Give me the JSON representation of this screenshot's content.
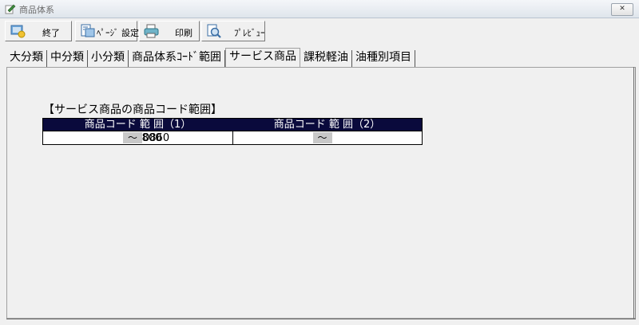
{
  "window": {
    "title": "商品体系",
    "close_label": "✕"
  },
  "toolbar": {
    "exit_label": "終了",
    "page_setup_label": "ﾍﾟｰｼﾞ 設定",
    "print_label": "印刷",
    "preview_label": "ﾌﾟﾚﾋﾞｭｰ"
  },
  "tabs": [
    {
      "label": "大分類"
    },
    {
      "label": "中分類"
    },
    {
      "label": "小分類"
    },
    {
      "label": "商品体系ｺｰﾄﾞ範囲"
    },
    {
      "label": "サービス商品"
    },
    {
      "label": "課税軽油"
    },
    {
      "label": "油種別項目"
    }
  ],
  "active_tab": "サービス商品",
  "section": {
    "title": "【サービス商品の商品コード範囲】",
    "columns": [
      "商品コード 範 囲（1）",
      "商品コード 範 囲（2）"
    ],
    "range1": {
      "from": "0800",
      "separator": "～",
      "to": "0860"
    },
    "range2": {
      "from": "",
      "separator": "～",
      "to": ""
    }
  },
  "colors": {
    "header_bg": "#0a0a3c",
    "header_fg": "#ffffff",
    "separator_bg": "#c8c8c8"
  }
}
